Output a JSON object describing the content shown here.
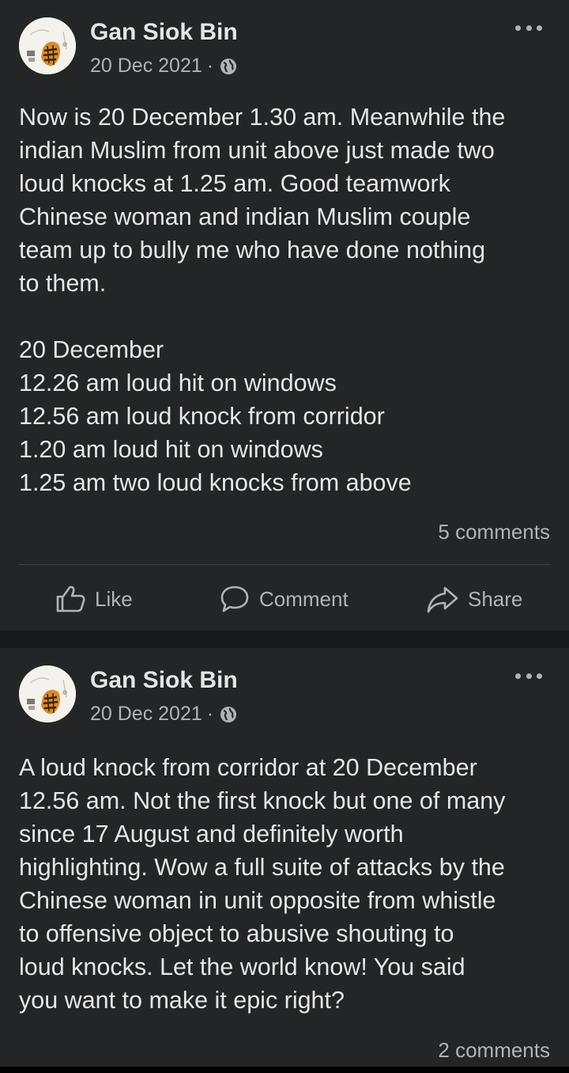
{
  "posts": [
    {
      "author": "Gan Siok Bin",
      "date": "20 Dec 2021",
      "separator": "·",
      "privacy_icon": "globe-icon",
      "body": "Now is 20 December 1.30 am. Meanwhile the\nindian Muslim from unit above just made two\nloud knocks at 1.25 am. Good teamwork\nChinese woman and indian Muslim couple\nteam up to bully me who have done nothing\nto them.\n\n20 December\n12.26 am loud hit on windows\n12.56 am loud knock from corridor\n1.20 am loud hit on windows\n1.25 am two loud knocks from above",
      "comments": "5 comments",
      "actions": {
        "like": "Like",
        "comment": "Comment",
        "share": "Share"
      }
    },
    {
      "author": "Gan Siok Bin",
      "date": "20 Dec 2021",
      "separator": "·",
      "privacy_icon": "globe-icon",
      "body": "A loud knock from corridor at 20 December\n12.56 am. Not the first knock but one of many\nsince 17 August and definitely worth\nhighlighting. Wow a full suite of attacks by the\nChinese woman in unit opposite from whistle\nto offensive object to abusive shouting to\nloud knocks. Let the world know! You said\nyou want to make it epic right?",
      "comments": "2 comments"
    }
  ],
  "colors": {
    "background": "#18191a",
    "card": "#242526",
    "primary_text": "#e4e6eb",
    "secondary_text": "#b0b3b8",
    "divider": "#3e4042"
  }
}
